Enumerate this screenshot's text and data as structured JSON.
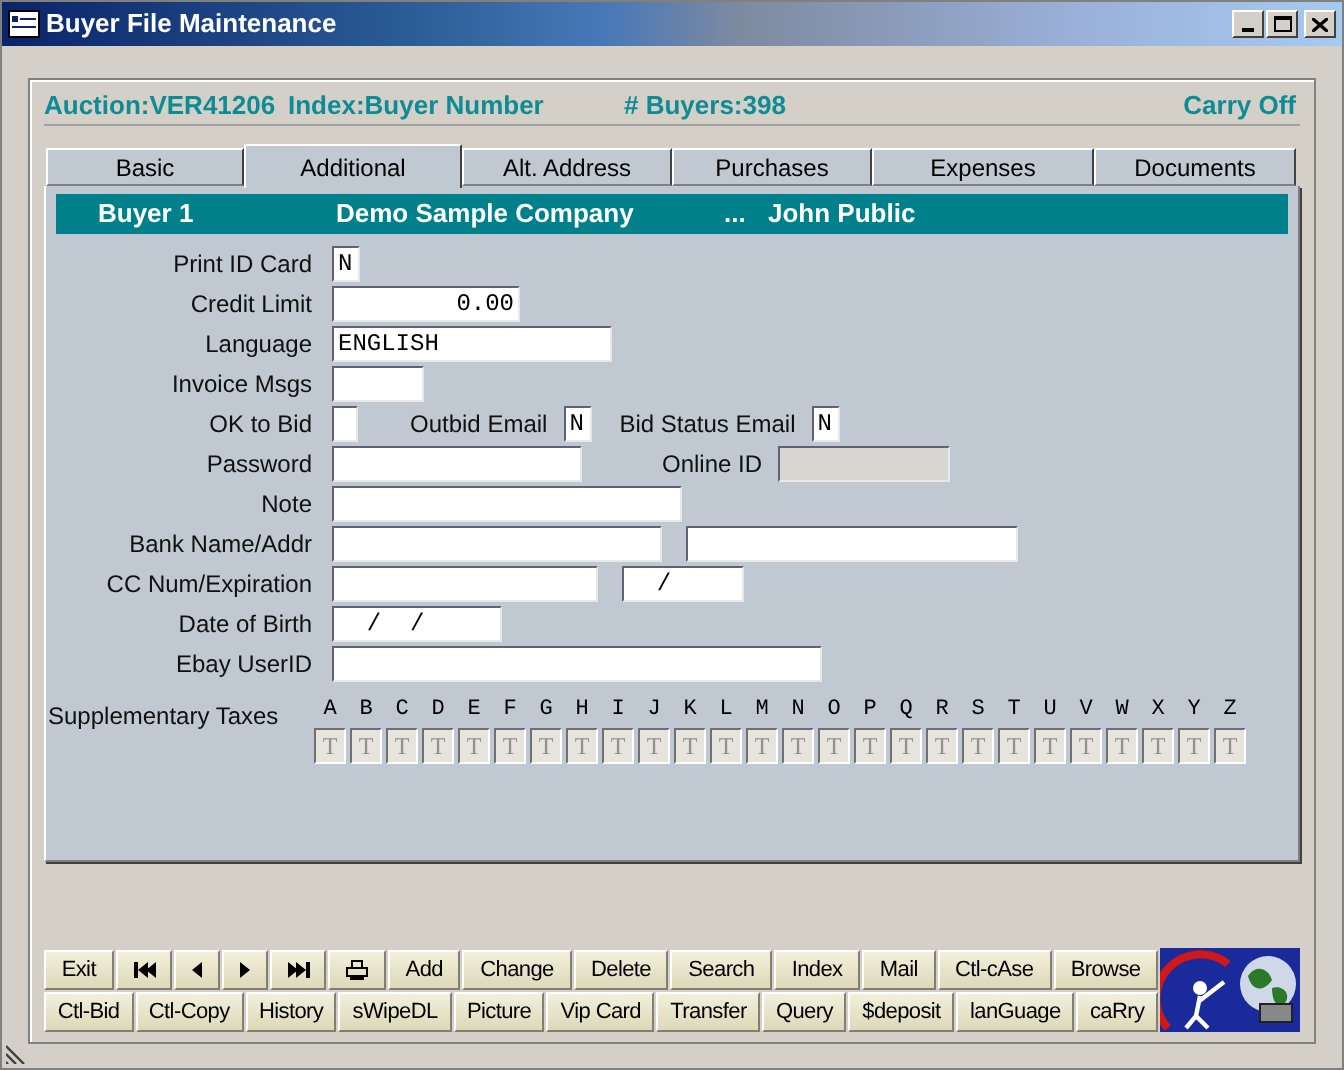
{
  "window": {
    "title": "Buyer File Maintenance"
  },
  "header": {
    "auction": "Auction:VER41206",
    "index": "Index:Buyer Number",
    "buyers": "# Buyers:398",
    "carry": "Carry Off"
  },
  "tabs": [
    {
      "label": "Basic",
      "selected": false
    },
    {
      "label": "Additional",
      "selected": true
    },
    {
      "label": "Alt. Address",
      "selected": false
    },
    {
      "label": "Purchases",
      "selected": false
    },
    {
      "label": "Expenses",
      "selected": false
    },
    {
      "label": "Documents",
      "selected": false
    }
  ],
  "buyer_band": {
    "number": "Buyer 1",
    "company": "Demo Sample Company",
    "ellipsis": "...",
    "contact": "John Public"
  },
  "form_rows": [
    {
      "items": [
        {
          "kind": "label",
          "text": "Print ID Card"
        },
        {
          "kind": "field",
          "value": "N",
          "disabled": false
        }
      ]
    },
    {
      "items": [
        {
          "kind": "label",
          "text": "Credit Limit"
        },
        {
          "kind": "field",
          "value": "0.00",
          "disabled": false
        }
      ]
    },
    {
      "items": [
        {
          "kind": "label",
          "text": "Language"
        },
        {
          "kind": "field",
          "value": "ENGLISH",
          "disabled": false
        }
      ]
    },
    {
      "items": [
        {
          "kind": "label",
          "text": "Invoice Msgs"
        },
        {
          "kind": "field",
          "disabled": false
        }
      ]
    },
    {
      "items": [
        {
          "kind": "label",
          "text": "OK to Bid"
        },
        {
          "kind": "field",
          "disabled": false
        },
        {
          "kind": "label",
          "text": "Outbid Email"
        },
        {
          "kind": "field",
          "value": "N",
          "disabled": false
        },
        {
          "kind": "label",
          "text": "Bid Status Email"
        },
        {
          "kind": "field",
          "value": "N",
          "disabled": false
        }
      ]
    },
    {
      "items": [
        {
          "kind": "label",
          "text": "Password"
        },
        {
          "kind": "field",
          "disabled": false
        },
        {
          "kind": "label",
          "text": "Online ID"
        },
        {
          "kind": "field",
          "disabled": true
        }
      ]
    },
    {
      "items": [
        {
          "kind": "label",
          "text": "Note"
        },
        {
          "kind": "field",
          "disabled": false
        }
      ]
    },
    {
      "items": [
        {
          "kind": "label",
          "text": "Bank Name/Addr"
        },
        {
          "kind": "field",
          "disabled": false
        },
        {
          "kind": "field",
          "disabled": false
        }
      ]
    },
    {
      "items": [
        {
          "kind": "label",
          "text": "CC Num/Expiration"
        },
        {
          "kind": "field",
          "disabled": false
        },
        {
          "kind": "field",
          "value": "  /",
          "disabled": false
        }
      ]
    },
    {
      "items": [
        {
          "kind": "label",
          "text": "Date of Birth"
        },
        {
          "kind": "field",
          "value": "  /  /",
          "disabled": false
        }
      ]
    },
    {
      "items": [
        {
          "kind": "label",
          "text": "Ebay UserID"
        },
        {
          "kind": "field",
          "disabled": false
        }
      ]
    }
  ],
  "supplementary_taxes": {
    "label": "Supplementary Taxes",
    "columns": [
      {
        "letter": "A",
        "value": "T",
        "disabled": true
      },
      {
        "letter": "B",
        "value": "T",
        "disabled": true
      },
      {
        "letter": "C",
        "value": "T",
        "disabled": true
      },
      {
        "letter": "D",
        "value": "T",
        "disabled": true
      },
      {
        "letter": "E",
        "value": "T",
        "disabled": true
      },
      {
        "letter": "F",
        "value": "T",
        "disabled": true
      },
      {
        "letter": "G",
        "value": "T",
        "disabled": true
      },
      {
        "letter": "H",
        "value": "T",
        "disabled": true
      },
      {
        "letter": "I",
        "value": "T",
        "disabled": true
      },
      {
        "letter": "J",
        "value": "T",
        "disabled": true
      },
      {
        "letter": "K",
        "value": "T",
        "disabled": true
      },
      {
        "letter": "L",
        "value": "T",
        "disabled": true
      },
      {
        "letter": "M",
        "value": "T",
        "disabled": true
      },
      {
        "letter": "N",
        "value": "T",
        "disabled": true
      },
      {
        "letter": "O",
        "value": "T",
        "disabled": true
      },
      {
        "letter": "P",
        "value": "T",
        "disabled": true
      },
      {
        "letter": "Q",
        "value": "T",
        "disabled": true
      },
      {
        "letter": "R",
        "value": "T",
        "disabled": true
      },
      {
        "letter": "S",
        "value": "T",
        "disabled": true
      },
      {
        "letter": "T",
        "value": "T",
        "disabled": true
      },
      {
        "letter": "U",
        "value": "T",
        "disabled": true
      },
      {
        "letter": "V",
        "value": "T",
        "disabled": true
      },
      {
        "letter": "W",
        "value": "T",
        "disabled": true
      },
      {
        "letter": "X",
        "value": "T",
        "disabled": true
      },
      {
        "letter": "Y",
        "value": "T",
        "disabled": true
      },
      {
        "letter": "Z",
        "value": "T",
        "disabled": true
      }
    ]
  },
  "toolbar_rows": [
    [
      {
        "kind": "text",
        "label": "Exit"
      },
      {
        "kind": "icon"
      },
      {
        "kind": "icon"
      },
      {
        "kind": "icon"
      },
      {
        "kind": "icon"
      },
      {
        "kind": "icon"
      },
      {
        "kind": "text",
        "label": "Add"
      },
      {
        "kind": "text",
        "label": "Change"
      },
      {
        "kind": "text",
        "label": "Delete"
      },
      {
        "kind": "text",
        "label": "Search"
      },
      {
        "kind": "text",
        "label": "Index"
      },
      {
        "kind": "text",
        "label": "Mail"
      },
      {
        "kind": "text",
        "label": "Ctl-cAse"
      },
      {
        "kind": "text",
        "label": "Browse"
      }
    ],
    [
      {
        "kind": "text",
        "label": "Ctl-Bid"
      },
      {
        "kind": "text",
        "label": "Ctl-Copy"
      },
      {
        "kind": "text",
        "label": "History"
      },
      {
        "kind": "text",
        "label": "sWipeDL"
      },
      {
        "kind": "text",
        "label": "Picture"
      },
      {
        "kind": "text",
        "label": "Vip Card"
      },
      {
        "kind": "text",
        "label": "Transfer"
      },
      {
        "kind": "text",
        "label": "Query"
      },
      {
        "kind": "text",
        "label": "$deposit"
      },
      {
        "kind": "text",
        "label": "lanGuage"
      },
      {
        "kind": "text",
        "label": "caRry"
      }
    ]
  ]
}
